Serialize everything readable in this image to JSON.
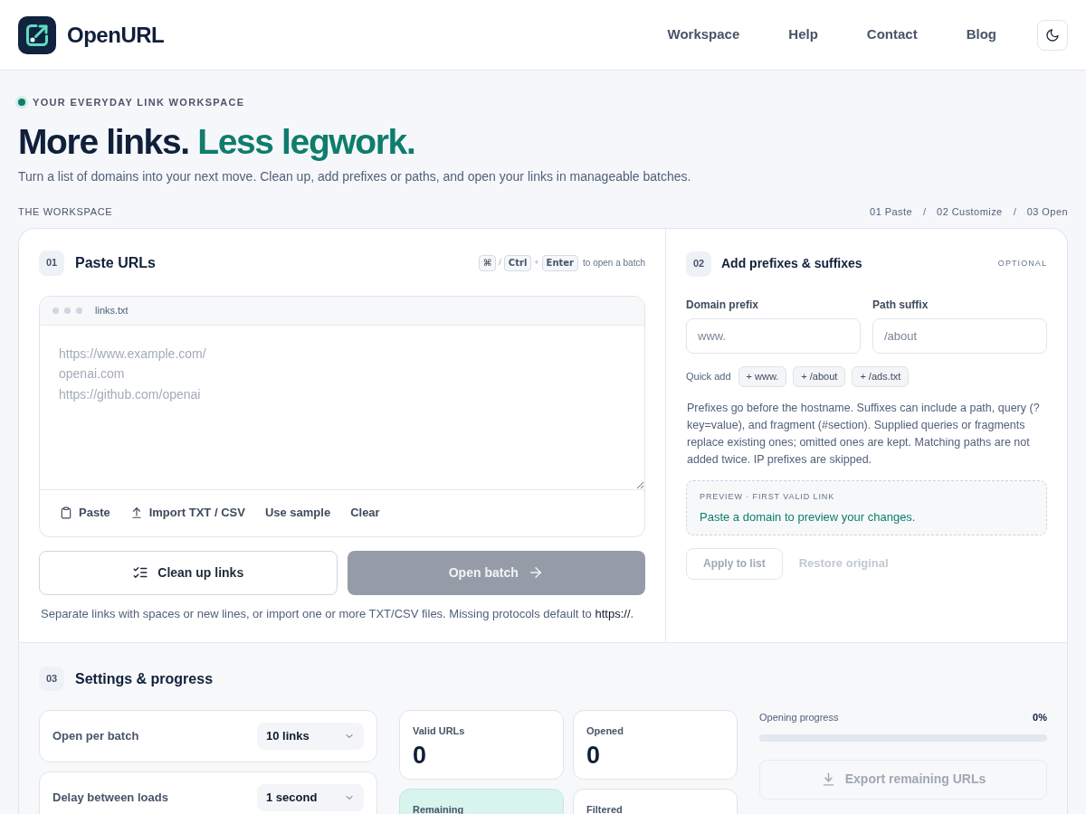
{
  "header": {
    "brand": "OpenURL",
    "nav": [
      "Workspace",
      "Help",
      "Contact",
      "Blog"
    ]
  },
  "hero": {
    "eyebrow": "YOUR EVERYDAY LINK WORKSPACE",
    "title": "More links. *Less legwork.*",
    "subtitle": "Turn a list of domains into your next move. Clean up, add prefixes or paths, and open your links in manageable batches."
  },
  "workspace": {
    "label": "THE WORKSPACE",
    "steps": [
      {
        "kind": "step",
        "text": "01 Paste"
      },
      {
        "kind": "separator",
        "text": "/"
      },
      {
        "kind": "step",
        "text": "02 Customize"
      },
      {
        "kind": "separator",
        "text": "/"
      },
      {
        "kind": "step",
        "text": "03 Open"
      }
    ]
  },
  "paste_panel": {
    "number": "01",
    "title": "Paste URLs",
    "shortcut": [
      {
        "kind": "key",
        "text": "⌘"
      },
      {
        "kind": "separator",
        "text": "/"
      },
      {
        "kind": "key",
        "text": "Ctrl"
      },
      {
        "kind": "separator",
        "text": "+"
      },
      {
        "kind": "key",
        "text": "Enter"
      },
      {
        "kind": "hint",
        "text": "to open a batch"
      }
    ],
    "file_name": "links.txt",
    "placeholder": "https://www.example.com/\nopenai.com\nhttps://github.com/openai",
    "tools": [
      {
        "kind": "paste",
        "label": "Paste"
      },
      {
        "kind": "import",
        "label": "Import TXT / CSV"
      },
      {
        "kind": "text",
        "label": "Use sample"
      },
      {
        "kind": "text",
        "label": "Clear"
      }
    ],
    "actions": [
      {
        "kind": "secondary",
        "label": "Clean up links",
        "disabled": false
      },
      {
        "kind": "primary",
        "label": "Open batch",
        "disabled": true
      }
    ],
    "note": "Separate links with spaces or new lines, or import one or more TXT/CSV files. Missing protocols default to **https://**."
  },
  "prefix_panel": {
    "number": "02",
    "title": "Add prefixes & suffixes",
    "badge": "OPTIONAL",
    "fields": [
      {
        "label": "Domain prefix",
        "placeholder": "www."
      },
      {
        "label": "Path suffix",
        "placeholder": "/about"
      }
    ],
    "quick_add": {
      "label": "Quick add",
      "chips": [
        "+ www.",
        "+ /about",
        "+ /ads.txt"
      ]
    },
    "help": "Prefixes go before the hostname. Suffixes can include a path, query (?key=value), and fragment (#section). Supplied queries or fragments replace existing ones; omitted ones are kept. Matching paths are not added twice. IP prefixes are skipped.",
    "preview": {
      "label": "PREVIEW · FIRST VALID LINK",
      "text": "Paste a domain to preview your changes."
    },
    "actions": [
      {
        "kind": "outline",
        "label": "Apply to list",
        "disabled": true
      },
      {
        "kind": "ghost",
        "label": "Restore original",
        "disabled": true
      }
    ]
  },
  "settings_panel": {
    "number": "03",
    "title": "Settings & progress",
    "settings": [
      {
        "label": "Open per batch",
        "value": "10 links"
      },
      {
        "label": "Delay between loads",
        "value": "1 second"
      }
    ],
    "stats": [
      {
        "label": "Valid URLs",
        "value": "0",
        "highlighted": false
      },
      {
        "label": "Opened",
        "value": "0",
        "highlighted": false
      },
      {
        "label": "Remaining",
        "highlighted": true
      },
      {
        "label": "Filtered",
        "highlighted": false
      }
    ],
    "progress": {
      "label": "Opening progress",
      "reading": "0%",
      "level": 0
    },
    "export": {
      "label": "Export remaining URLs",
      "disabled": true
    }
  }
}
